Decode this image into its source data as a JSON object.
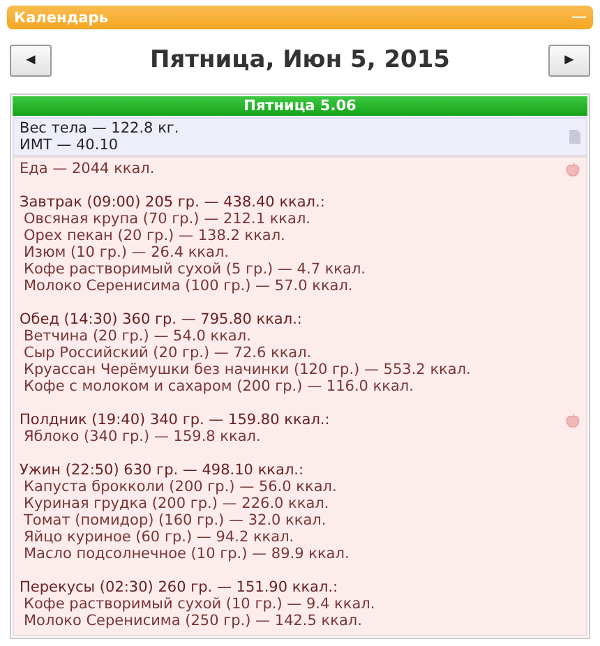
{
  "panel": {
    "title": "Календарь",
    "collapse": "—"
  },
  "nav": {
    "prev": "◄",
    "date": "Пятница, Июн 5, 2015",
    "next": "►"
  },
  "day": {
    "title": "Пятница 5.06"
  },
  "body": {
    "lines": [
      "Вес тела — 122.8 кг.",
      "ИМТ — 40.10"
    ]
  },
  "food": {
    "total": "Еда — 2044 ккал.",
    "meals": [
      {
        "title": "Завтрак (09:00) 205 гр. — 438.40 ккал.:",
        "marked": false,
        "items": [
          "Овсяная крупа (70 гр.) — 212.1 ккал.",
          "Орех пекан (20 гр.) — 138.2 ккал.",
          "Изюм (10 гр.) — 26.4 ккал.",
          "Кофе растворимый сухой (5 гр.) — 4.7 ккал.",
          "Молоко Серенисима (100 гр.) — 57.0 ккал."
        ]
      },
      {
        "title": "Обед (14:30) 360 гр. — 795.80 ккал.:",
        "marked": false,
        "items": [
          "Ветчина (20 гр.) — 54.0 ккал.",
          "Сыр Российский (20 гр.) — 72.6 ккал.",
          "Круассан Черёмушки без начинки (120 гр.) — 553.2 ккал.",
          "Кофе с молоком и сахаром (200 гр.) — 116.0 ккал."
        ]
      },
      {
        "title": "Полдник (19:40) 340 гр. — 159.80 ккал.:",
        "marked": true,
        "items": [
          "Яблоко (340 гр.) — 159.8 ккал."
        ]
      },
      {
        "title": "Ужин (22:50) 630 гр. — 498.10 ккал.:",
        "marked": false,
        "items": [
          "Капуста брокколи (200 гр.) — 56.0 ккал.",
          "Куриная грудка (200 гр.) — 226.0 ккал.",
          "Томат (помидор) (160 гр.) — 32.0 ккал.",
          "Яйцо куриное (60 гр.) — 94.2 ккал.",
          "Масло подсолнечное (10 гр.) — 89.9 ккал."
        ]
      },
      {
        "title": "Перекусы (02:30) 260 гр. — 151.90 ккал.:",
        "marked": false,
        "items": [
          "Кофе растворимый сухой (10 гр.) — 9.4 ккал.",
          "Молоко Серенисима (250 гр.) — 142.5 ккал."
        ]
      }
    ]
  }
}
